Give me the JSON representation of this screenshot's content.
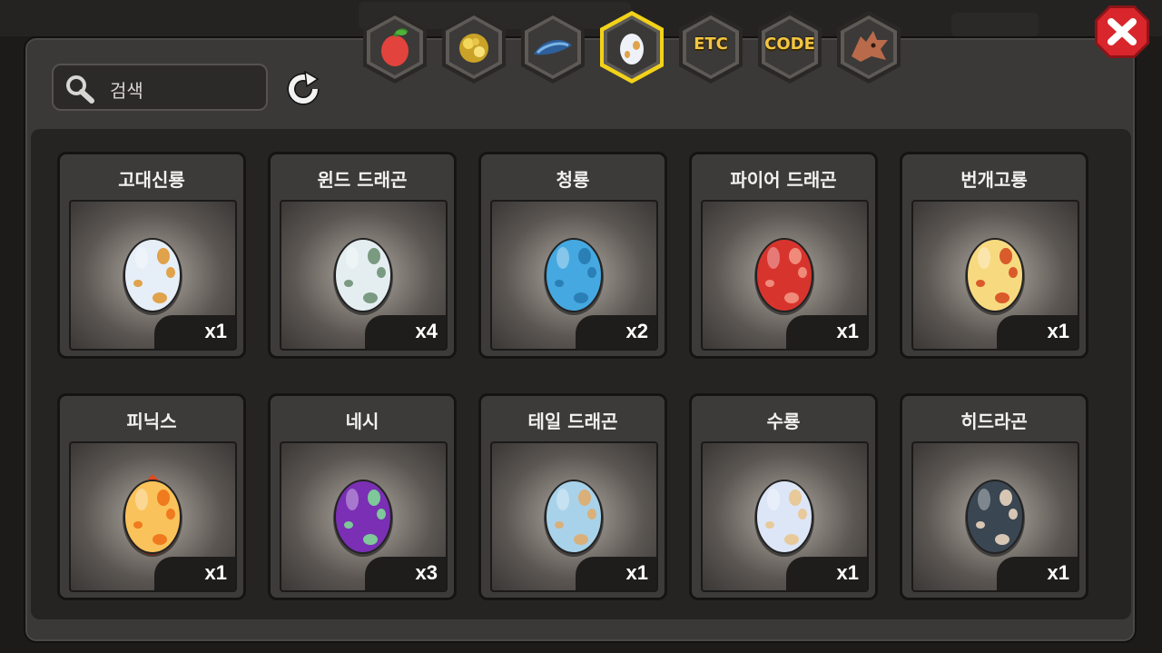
{
  "search": {
    "placeholder": "검색"
  },
  "tabs": [
    {
      "id": "fruit",
      "icon": "fruit-icon",
      "label": ""
    },
    {
      "id": "ore",
      "icon": "gold-ore-icon",
      "label": ""
    },
    {
      "id": "fish",
      "icon": "fish-icon",
      "label": ""
    },
    {
      "id": "egg",
      "icon": "egg-icon",
      "label": "",
      "selected": true
    },
    {
      "id": "etc",
      "icon": "",
      "label": "ETC"
    },
    {
      "id": "code",
      "icon": "",
      "label": "CODE"
    },
    {
      "id": "dragon",
      "icon": "dragon-head-icon",
      "label": ""
    }
  ],
  "items": [
    {
      "name": "고대신룡",
      "count": "x1",
      "base": "#e6eef7",
      "spot": "#e0a24a",
      "fire": false
    },
    {
      "name": "윈드 드래곤",
      "count": "x4",
      "base": "#e4eef0",
      "spot": "#7a9a82",
      "fire": false
    },
    {
      "name": "청룡",
      "count": "x2",
      "base": "#45a8e0",
      "spot": "#2a7fb6",
      "fire": false
    },
    {
      "name": "파이어 드래곤",
      "count": "x1",
      "base": "#d8342e",
      "spot": "#f08a7a",
      "fire": false
    },
    {
      "name": "번개고룡",
      "count": "x1",
      "base": "#f7d980",
      "spot": "#d95a2a",
      "fire": false
    },
    {
      "name": "피닉스",
      "count": "x1",
      "base": "#f9c25a",
      "spot": "#f07a1e",
      "fire": true
    },
    {
      "name": "네시",
      "count": "x3",
      "base": "#7a2fb4",
      "spot": "#7ec89a",
      "fire": false
    },
    {
      "name": "테일 드래곤",
      "count": "x1",
      "base": "#a8d2ea",
      "spot": "#d9b07a",
      "fire": false
    },
    {
      "name": "수룡",
      "count": "x1",
      "base": "#dde6f7",
      "spot": "#e8c99a",
      "fire": false
    },
    {
      "name": "히드라곤",
      "count": "x1",
      "base": "#3a4652",
      "spot": "#d8c6b4",
      "fire": false
    }
  ],
  "colors": {
    "tab_selected_border": "#f2d21a",
    "close_button": "#d8262c",
    "tab_text": "#f4c542"
  }
}
